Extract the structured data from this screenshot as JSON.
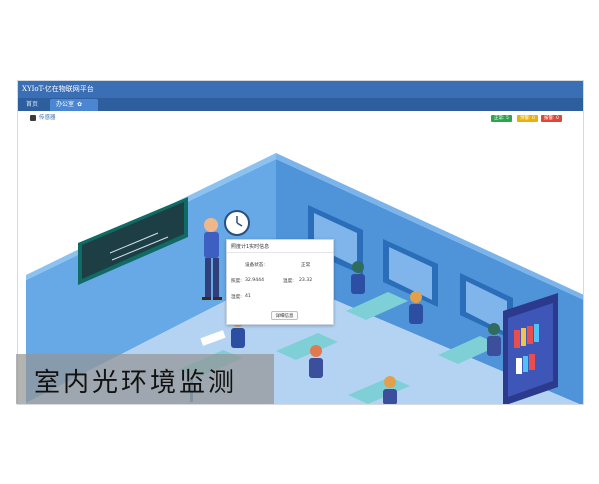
{
  "window": {
    "title": "XYIoT-亿在物联网平台"
  },
  "tabs": [
    {
      "label": "首页"
    },
    {
      "label": "办公室"
    }
  ],
  "toolbar": {
    "sensor_label": "传感器",
    "badges": {
      "normal": "正常: 5",
      "warning": "预警: 0",
      "alarm": "报警: 0"
    }
  },
  "popup": {
    "title": "照度计1实时信息",
    "status_label": "设备状态:",
    "status_value": "正常",
    "illuminance_label": "照度:",
    "illuminance_value": "32.9444",
    "temperature_label": "温度:",
    "temperature_value": "23.32",
    "humidity_label": "湿度:",
    "humidity_value": "41",
    "details_button": "详细信息"
  },
  "caption": {
    "text": "室内光环境监测"
  },
  "colors": {
    "titlebar": "#3b6fb5",
    "tabbar": "#2f5e9e",
    "active_tab": "#4a86d1",
    "normal": "#2ea44f",
    "warning": "#e8b10e",
    "alarm": "#e0463a",
    "wall": "#5b9fe0",
    "floor": "#aeccef"
  },
  "icons": {
    "checkbox": "checkbox-checked-icon",
    "settings": "gear-icon",
    "sensor_marker": "sensor-marker-icon",
    "clock": "clock-icon"
  }
}
